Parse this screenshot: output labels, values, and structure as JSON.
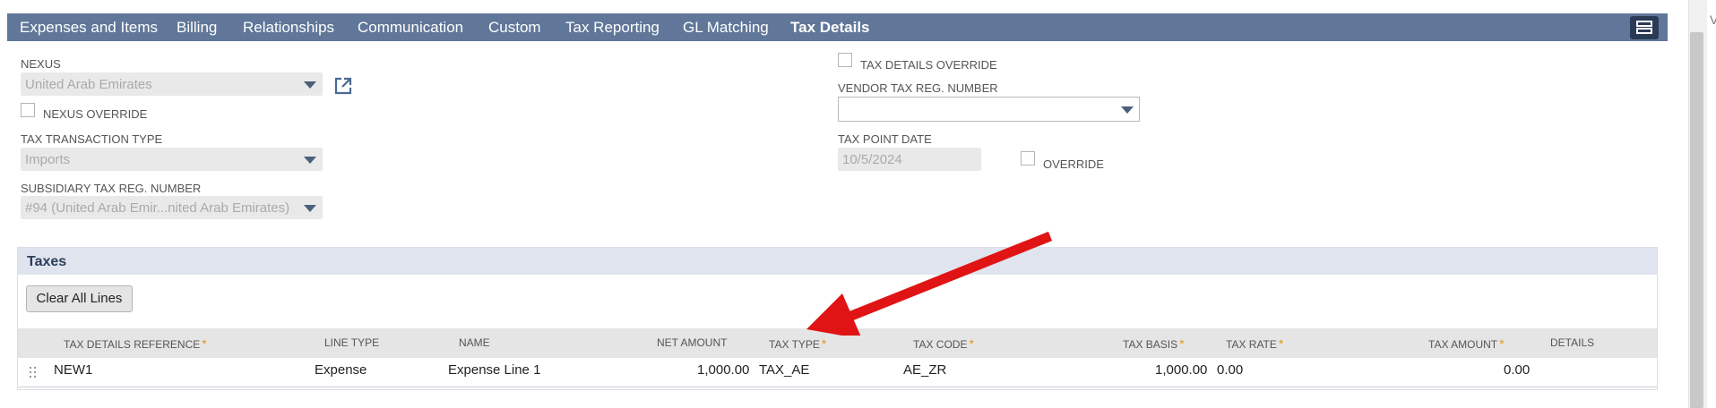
{
  "tabs": [
    {
      "label": "Expenses and Items",
      "active": false
    },
    {
      "label": "Billing",
      "active": false
    },
    {
      "label": "Relationships",
      "active": false
    },
    {
      "label": "Communication",
      "active": false
    },
    {
      "label": "Custom",
      "active": false
    },
    {
      "label": "Tax Reporting",
      "active": false
    },
    {
      "label": "GL Matching",
      "active": false
    },
    {
      "label": "Tax Details",
      "active": true
    }
  ],
  "form": {
    "nexus_label": "NEXUS",
    "nexus_value": "United Arab Emirates",
    "nexus_override_label": "NEXUS OVERRIDE",
    "tax_transaction_type_label": "TAX TRANSACTION TYPE",
    "tax_transaction_type_value": "Imports",
    "subsidiary_tax_reg_label": "SUBSIDIARY TAX REG. NUMBER",
    "subsidiary_tax_reg_value": "#94 (United Arab Emir...nited Arab Emirates)",
    "tax_details_override_label": "TAX DETAILS OVERRIDE",
    "vendor_tax_reg_label": "VENDOR TAX REG. NUMBER",
    "vendor_tax_reg_value": "",
    "tax_point_date_label": "TAX POINT DATE",
    "tax_point_date_value": "10/5/2024",
    "override_label": "OVERRIDE"
  },
  "taxes": {
    "title": "Taxes",
    "clear_button": "Clear All Lines",
    "columns": [
      "TAX DETAILS REFERENCE",
      "LINE TYPE",
      "NAME",
      "NET AMOUNT",
      "TAX TYPE",
      "TAX CODE",
      "TAX BASIS",
      "TAX RATE",
      "TAX AMOUNT",
      "DETAILS"
    ],
    "rows": [
      {
        "ref": "NEW1",
        "line_type": "Expense",
        "name": "Expense Line 1",
        "net_amount": "1,000.00",
        "tax_type": "TAX_AE",
        "tax_code": "AE_ZR",
        "tax_basis": "1,000.00",
        "tax_rate": "0.00",
        "tax_amount": "0.00",
        "details": ""
      }
    ]
  },
  "edge_text": "V",
  "colors": {
    "tab_bar": "#607799",
    "section_header": "#dfe4ee",
    "required": "#e6961e",
    "annotation_arrow": "#e01414"
  },
  "icons": {
    "dropdown": "chevron-down-icon",
    "open_record": "external-link-icon",
    "layout": "layout-toggle-icon",
    "drag": "drag-handle-icon"
  }
}
